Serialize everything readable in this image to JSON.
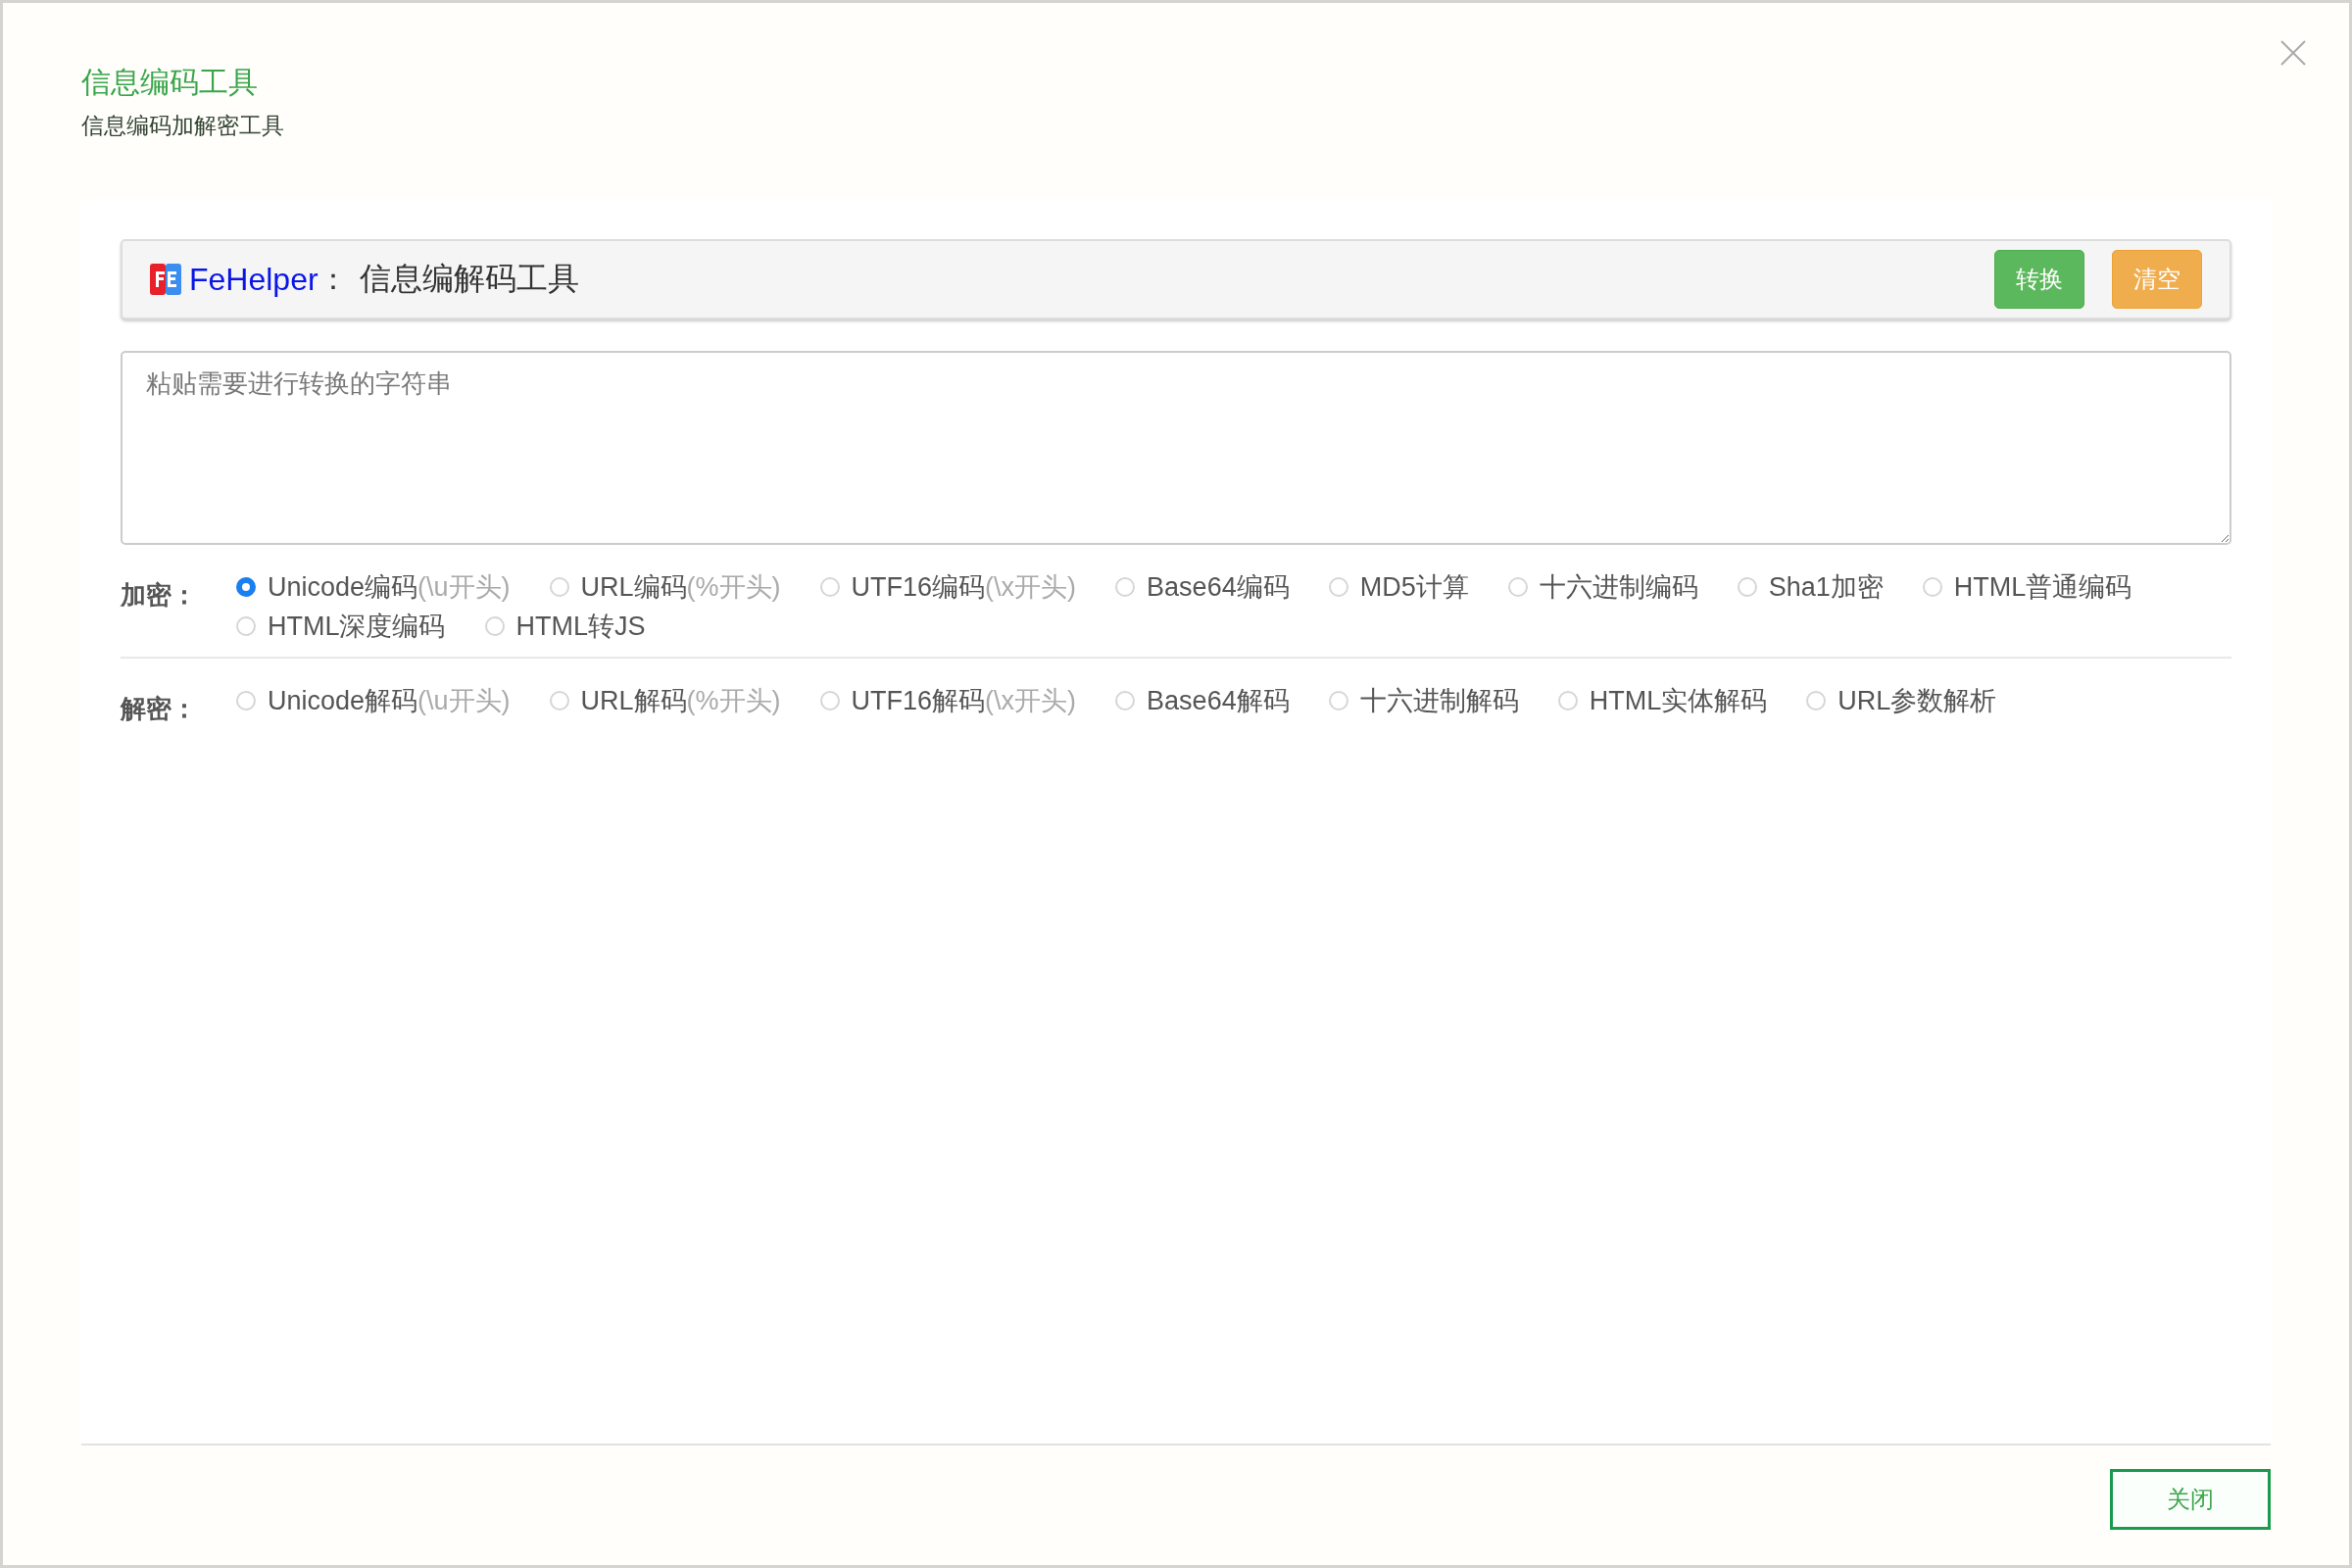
{
  "dialog": {
    "title": "信息编码工具",
    "subtitle": "信息编码加解密工具"
  },
  "toolbar": {
    "brand": "FeHelper",
    "separator": "：",
    "tool_name": "信息编解码工具",
    "buttons": [
      {
        "label": "转换",
        "kind": "primary"
      },
      {
        "label": "清空",
        "kind": "warning"
      }
    ]
  },
  "input": {
    "placeholder": "粘贴需要进行转换的字符串"
  },
  "groups": [
    {
      "label": "加密：",
      "options": [
        {
          "label": "Unicode编码",
          "hint": "(\\u开头)",
          "selected": true
        },
        {
          "label": "URL编码",
          "hint": "(%开头)",
          "selected": false
        },
        {
          "label": "UTF16编码",
          "hint": "(\\x开头)",
          "selected": false
        },
        {
          "label": "Base64编码",
          "selected": false
        },
        {
          "label": "MD5计算",
          "selected": false
        },
        {
          "label": "十六进制编码",
          "selected": false
        },
        {
          "label": "Sha1加密",
          "selected": false
        },
        {
          "label": "HTML普通编码",
          "selected": false
        },
        {
          "label": "HTML深度编码",
          "selected": false
        },
        {
          "label": "HTML转JS",
          "selected": false
        }
      ]
    },
    {
      "label": "解密：",
      "options": [
        {
          "label": "Unicode解码",
          "hint": "(\\u开头)",
          "selected": false
        },
        {
          "label": "URL解码",
          "hint": "(%开头)",
          "selected": false
        },
        {
          "label": "UTF16解码",
          "hint": "(\\x开头)",
          "selected": false
        },
        {
          "label": "Base64解码",
          "selected": false
        },
        {
          "label": "十六进制解码",
          "selected": false
        },
        {
          "label": "HTML实体解码",
          "selected": false
        },
        {
          "label": "URL参数解析",
          "selected": false
        }
      ]
    }
  ],
  "footer": {
    "close_button": "关闭"
  }
}
